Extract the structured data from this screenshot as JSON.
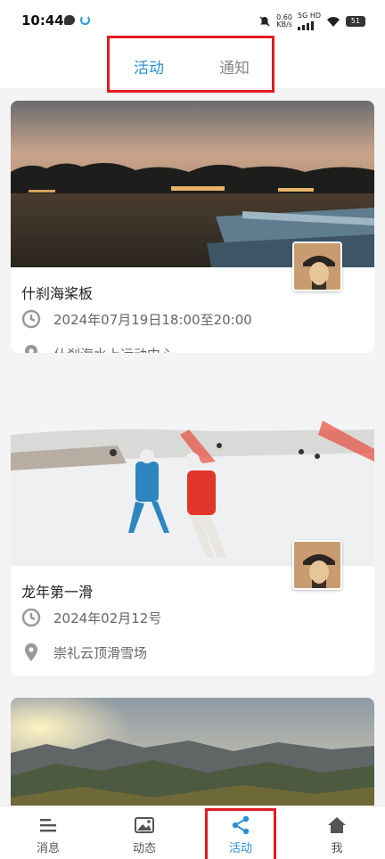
{
  "status_bar": {
    "time": "10:44",
    "net_speed_value": "0.60",
    "net_speed_unit": "KB/s",
    "network_label": "5G HD",
    "battery": "51"
  },
  "top_tabs": {
    "active": "活动",
    "inactive": "通知",
    "accent_color": "#2b8fd6",
    "highlight_color": "#e11b22"
  },
  "events": [
    {
      "title": "什刹海桨板",
      "time": "2024年07月19日18:00至20:00",
      "location": "什刹海水上运动中心"
    },
    {
      "title": "龙年第一滑",
      "time": "2024年02月12号",
      "location": "崇礼云顶滑雪场"
    },
    {
      "title": "",
      "time": "",
      "location": ""
    }
  ],
  "bottom_nav": {
    "items": [
      {
        "label": "消息",
        "icon": "menu-icon"
      },
      {
        "label": "动态",
        "icon": "gallery-icon"
      },
      {
        "label": "活动",
        "icon": "share-icon"
      },
      {
        "label": "我",
        "icon": "home-icon"
      }
    ],
    "active_index": 2
  }
}
